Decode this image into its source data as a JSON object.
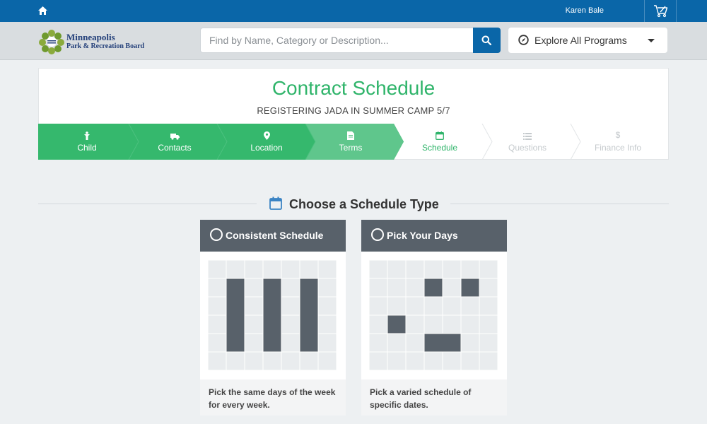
{
  "topbar": {
    "user_name": "Karen Bale",
    "icons": [
      "home-icon",
      "cart-icon"
    ],
    "background": "#0a66a8"
  },
  "header": {
    "logo": {
      "line1": "Minneapolis",
      "line2": "Park & Recreation Board"
    },
    "search": {
      "placeholder": "Find by Name, Category or Description...",
      "value": ""
    },
    "explore": {
      "label": "Explore All Programs",
      "icon": "compass-icon"
    }
  },
  "page": {
    "title": "Contract Schedule",
    "subtitle": "REGISTERING JADA IN SUMMER CAMP 5/7"
  },
  "steps": [
    {
      "label": "Child",
      "icon": "child-icon",
      "state": "done"
    },
    {
      "label": "Contacts",
      "icon": "truck-icon",
      "state": "done"
    },
    {
      "label": "Location",
      "icon": "map-marker-icon",
      "state": "done"
    },
    {
      "label": "Terms",
      "icon": "document-icon",
      "state": "current-done"
    },
    {
      "label": "Schedule",
      "icon": "calendar-icon",
      "state": "active"
    },
    {
      "label": "Questions",
      "icon": "list-icon",
      "state": "pending"
    },
    {
      "label": "Finance Info",
      "icon": "dollar-icon",
      "state": "pending"
    }
  ],
  "section": {
    "title": "Choose a Schedule Type",
    "icon": "calendar-icon"
  },
  "options": [
    {
      "title": "Consistent Schedule",
      "description": "Pick the same days of the week for every week.",
      "pattern": "consistent-columns"
    },
    {
      "title": "Pick Your Days",
      "description": "Pick a varied schedule of specific dates.",
      "pattern": "varied-days"
    }
  ],
  "colors": {
    "accent_green": "#2fb46a",
    "step_done": "#35b86d",
    "step_current": "#5fc68c",
    "step_active_text": "#2fb46a",
    "step_pending_text": "#c5cacd",
    "option_header": "#58616a",
    "grid_fill": "#58616a",
    "grid_cell": "#e9ecee"
  }
}
